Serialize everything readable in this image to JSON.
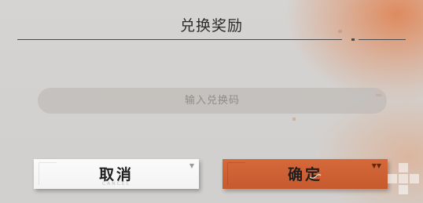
{
  "dialog": {
    "title": "兑换奖励",
    "code_input": {
      "placeholder": "输入兑换码",
      "value": ""
    },
    "cancel_button": {
      "label": "取消",
      "sublabel": "CANCEL"
    },
    "confirm_button": {
      "label": "确定"
    }
  },
  "colors": {
    "background": "#d3d1cf",
    "accent": "#cf6134",
    "cancel_bg": "#f7f7f7",
    "text": "#1e1e1e"
  },
  "icons": [
    "corner-triangle-icon",
    "corner-triangle-icon",
    "watermark-icon"
  ]
}
